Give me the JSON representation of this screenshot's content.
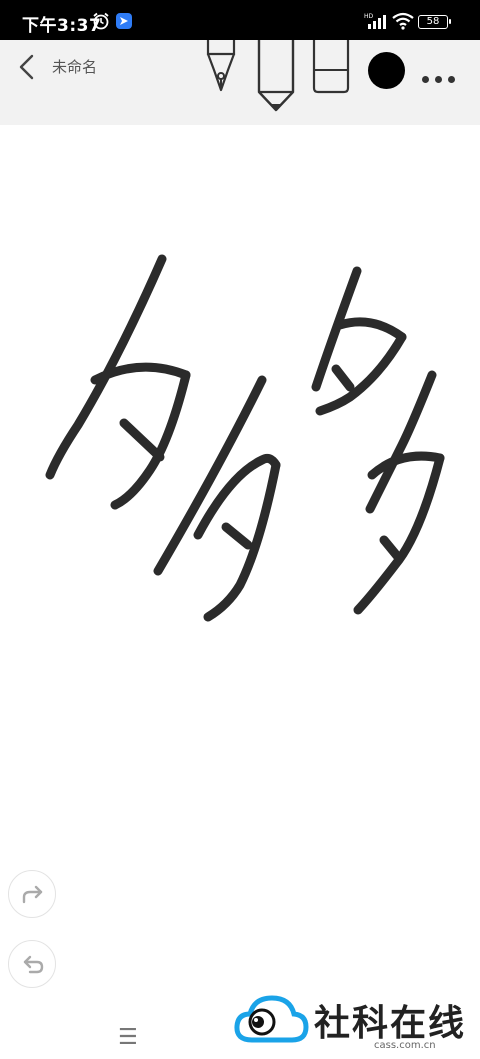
{
  "status_bar": {
    "time": "下午3:37",
    "battery": "58"
  },
  "toolbar": {
    "title": "未命名",
    "tools": [
      "fountain-pen",
      "pen",
      "eraser"
    ],
    "active_color": "#000000"
  },
  "canvas": {
    "ink_color": "#2b2b2b"
  },
  "controls": {
    "redo": "redo-icon",
    "undo": "undo-icon",
    "menu": "☰"
  },
  "watermark": {
    "brand": "社科在线",
    "url": "cass.com.cn",
    "accent": "#1aa3e8"
  }
}
